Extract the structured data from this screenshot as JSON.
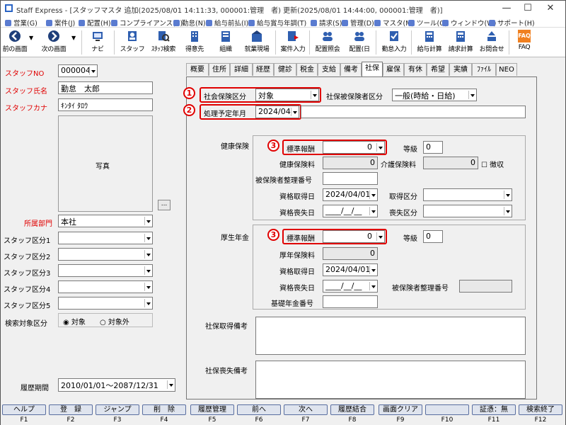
{
  "window": {
    "title": "Staff Express - [スタッフマスタ 追加(2025/08/01 14:11:33, 000001:管理　者) 更新(2025/08/01 14:44:00, 000001:管理　者)]"
  },
  "menu": [
    "営業(G)",
    "案件(J)",
    "配置(H)",
    "コンプライアンス(C)",
    "勤怠(N)",
    "給与前払(I)",
    "給与賞与年調(T)",
    "請求(S)",
    "管理(D)",
    "マスタ(M)",
    "ツール(O)",
    "ウィンドウ(W)",
    "サポート(H)"
  ],
  "toolbar": {
    "prev": "前の画面",
    "next": "次の画面",
    "navi": "ナビ",
    "staff": "スタッフ",
    "staff_search": "ｽﾀｯﾌ検索",
    "client": "得意先",
    "org": "組織",
    "site": "就業現場",
    "case_input": "案件入力",
    "assign_view": "配置照会",
    "assign_day": "配置(日",
    "attend_input": "勤怠入力",
    "pay_calc": "給与計算",
    "bill_calc": "請求計算",
    "inquiry": "お問合せ",
    "faq": "FAQ",
    "faq_icon": "FAQ"
  },
  "left": {
    "staff_no_label": "スタッフNO",
    "staff_no": "000004",
    "staff_name_label": "スタッフ氏名",
    "staff_name": "勤怠　太郎",
    "staff_kana_label": "スタッフカナ",
    "staff_kana": "ｷﾝﾀｲ ﾀﾛｳ",
    "photo_label": "写真",
    "photo_btn": "...",
    "dept_label": "所属部門",
    "dept": "本社",
    "kubun1": "スタッフ区分1",
    "kubun2": "スタッフ区分2",
    "kubun3": "スタッフ区分3",
    "kubun4": "スタッフ区分4",
    "kubun5": "スタッフ区分5",
    "search_label": "検索対象区分",
    "radio_yes": "対象",
    "radio_no": "対象外",
    "period_label": "履歴期間",
    "period": "2010/01/01～2087/12/31"
  },
  "tabs": [
    "概要",
    "住所",
    "詳細",
    "経歴",
    "健診",
    "税金",
    "支給",
    "備考",
    "社保",
    "雇保",
    "有休",
    "希望",
    "実績",
    "ﾌｧｲﾙ",
    "NEO"
  ],
  "panel": {
    "shaho_label": "社会保険区分",
    "shaho": "対象",
    "shaho_hihoken_label": "社保被保険者区分",
    "shaho_hihoken": "一般(時給・日給)",
    "shori_label": "処理予定年月",
    "shori": "2024/04",
    "kenko": {
      "title": "健康保険",
      "hyojun_label": "標準報酬",
      "hyojun": "0",
      "tokyu_label": "等級",
      "tokyu": "0",
      "ryo_label": "健康保険料",
      "ryo": "0",
      "kaigo_label": "介護保険料",
      "kaigo": "0",
      "choshu": "徴収",
      "seiri_label": "被保険者整理番号",
      "shutoku_label": "資格取得日",
      "shutoku": "2024/04/01",
      "shutoku_kubun": "取得区分",
      "soshitsu_label": "資格喪失日",
      "soshitsu": "____/__/__",
      "soshitsu_kubun": "喪失区分"
    },
    "kosei": {
      "title": "厚生年金",
      "hyojun_label": "標準報酬",
      "hyojun": "0",
      "tokyu_label": "等級",
      "tokyu": "0",
      "ryo_label": "厚年保険料",
      "ryo": "0",
      "shutoku_label": "資格取得日",
      "shutoku": "2024/04/01",
      "soshitsu_label": "資格喪失日",
      "soshitsu": "____/__/__",
      "seiri_label": "被保険者整理番号",
      "kiso_label": "基礎年金番号"
    },
    "shutoku_biko": "社保取得備考",
    "soshitsu_biko": "社保喪失備考"
  },
  "annot": {
    "c1": "1",
    "c2": "2",
    "c3": "3"
  },
  "fkeys": [
    {
      "label": "ヘルプ",
      "key": "F1"
    },
    {
      "label": "登　録",
      "key": "F2"
    },
    {
      "label": "ジャンプ",
      "key": "F3"
    },
    {
      "label": "削　除",
      "key": "F4"
    },
    {
      "label": "履歴管理",
      "key": "F5"
    },
    {
      "label": "前へ",
      "key": "F6"
    },
    {
      "label": "次へ",
      "key": "F7"
    },
    {
      "label": "履歴結合",
      "key": "F8"
    },
    {
      "label": "画面クリア",
      "key": "F9"
    },
    {
      "label": "",
      "key": "F10"
    },
    {
      "label": "証憑：無",
      "key": "F11"
    },
    {
      "label": "検索終了",
      "key": "F12"
    }
  ],
  "colors": {
    "required_label": "#e00000",
    "annotation": "#e00000",
    "fkey_bg": "#dfe4ee"
  }
}
